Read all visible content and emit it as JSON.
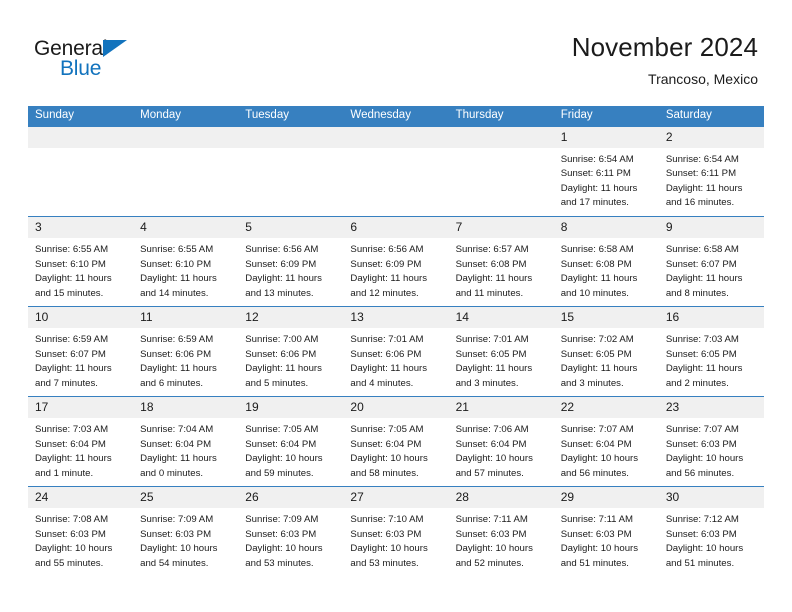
{
  "brand": {
    "name_part1": "General",
    "name_part2": "Blue",
    "accent_color": "#1273bd"
  },
  "header": {
    "title": "November 2024",
    "subtitle": "Trancoso, Mexico"
  },
  "theme": {
    "header_bg": "#3780c0",
    "daynum_bg": "#f0f0f0",
    "text_color": "#1b1b1b"
  },
  "calendar": {
    "weekday_headers": [
      "Sunday",
      "Monday",
      "Tuesday",
      "Wednesday",
      "Thursday",
      "Friday",
      "Saturday"
    ],
    "weeks": [
      [
        {
          "empty": true
        },
        {
          "empty": true
        },
        {
          "empty": true
        },
        {
          "empty": true
        },
        {
          "empty": true
        },
        {
          "day": "1",
          "sunrise": "Sunrise: 6:54 AM",
          "sunset": "Sunset: 6:11 PM",
          "daylight1": "Daylight: 11 hours",
          "daylight2": "and 17 minutes."
        },
        {
          "day": "2",
          "sunrise": "Sunrise: 6:54 AM",
          "sunset": "Sunset: 6:11 PM",
          "daylight1": "Daylight: 11 hours",
          "daylight2": "and 16 minutes."
        }
      ],
      [
        {
          "day": "3",
          "sunrise": "Sunrise: 6:55 AM",
          "sunset": "Sunset: 6:10 PM",
          "daylight1": "Daylight: 11 hours",
          "daylight2": "and 15 minutes."
        },
        {
          "day": "4",
          "sunrise": "Sunrise: 6:55 AM",
          "sunset": "Sunset: 6:10 PM",
          "daylight1": "Daylight: 11 hours",
          "daylight2": "and 14 minutes."
        },
        {
          "day": "5",
          "sunrise": "Sunrise: 6:56 AM",
          "sunset": "Sunset: 6:09 PM",
          "daylight1": "Daylight: 11 hours",
          "daylight2": "and 13 minutes."
        },
        {
          "day": "6",
          "sunrise": "Sunrise: 6:56 AM",
          "sunset": "Sunset: 6:09 PM",
          "daylight1": "Daylight: 11 hours",
          "daylight2": "and 12 minutes."
        },
        {
          "day": "7",
          "sunrise": "Sunrise: 6:57 AM",
          "sunset": "Sunset: 6:08 PM",
          "daylight1": "Daylight: 11 hours",
          "daylight2": "and 11 minutes."
        },
        {
          "day": "8",
          "sunrise": "Sunrise: 6:58 AM",
          "sunset": "Sunset: 6:08 PM",
          "daylight1": "Daylight: 11 hours",
          "daylight2": "and 10 minutes."
        },
        {
          "day": "9",
          "sunrise": "Sunrise: 6:58 AM",
          "sunset": "Sunset: 6:07 PM",
          "daylight1": "Daylight: 11 hours",
          "daylight2": "and 8 minutes."
        }
      ],
      [
        {
          "day": "10",
          "sunrise": "Sunrise: 6:59 AM",
          "sunset": "Sunset: 6:07 PM",
          "daylight1": "Daylight: 11 hours",
          "daylight2": "and 7 minutes."
        },
        {
          "day": "11",
          "sunrise": "Sunrise: 6:59 AM",
          "sunset": "Sunset: 6:06 PM",
          "daylight1": "Daylight: 11 hours",
          "daylight2": "and 6 minutes."
        },
        {
          "day": "12",
          "sunrise": "Sunrise: 7:00 AM",
          "sunset": "Sunset: 6:06 PM",
          "daylight1": "Daylight: 11 hours",
          "daylight2": "and 5 minutes."
        },
        {
          "day": "13",
          "sunrise": "Sunrise: 7:01 AM",
          "sunset": "Sunset: 6:06 PM",
          "daylight1": "Daylight: 11 hours",
          "daylight2": "and 4 minutes."
        },
        {
          "day": "14",
          "sunrise": "Sunrise: 7:01 AM",
          "sunset": "Sunset: 6:05 PM",
          "daylight1": "Daylight: 11 hours",
          "daylight2": "and 3 minutes."
        },
        {
          "day": "15",
          "sunrise": "Sunrise: 7:02 AM",
          "sunset": "Sunset: 6:05 PM",
          "daylight1": "Daylight: 11 hours",
          "daylight2": "and 3 minutes."
        },
        {
          "day": "16",
          "sunrise": "Sunrise: 7:03 AM",
          "sunset": "Sunset: 6:05 PM",
          "daylight1": "Daylight: 11 hours",
          "daylight2": "and 2 minutes."
        }
      ],
      [
        {
          "day": "17",
          "sunrise": "Sunrise: 7:03 AM",
          "sunset": "Sunset: 6:04 PM",
          "daylight1": "Daylight: 11 hours",
          "daylight2": "and 1 minute."
        },
        {
          "day": "18",
          "sunrise": "Sunrise: 7:04 AM",
          "sunset": "Sunset: 6:04 PM",
          "daylight1": "Daylight: 11 hours",
          "daylight2": "and 0 minutes."
        },
        {
          "day": "19",
          "sunrise": "Sunrise: 7:05 AM",
          "sunset": "Sunset: 6:04 PM",
          "daylight1": "Daylight: 10 hours",
          "daylight2": "and 59 minutes."
        },
        {
          "day": "20",
          "sunrise": "Sunrise: 7:05 AM",
          "sunset": "Sunset: 6:04 PM",
          "daylight1": "Daylight: 10 hours",
          "daylight2": "and 58 minutes."
        },
        {
          "day": "21",
          "sunrise": "Sunrise: 7:06 AM",
          "sunset": "Sunset: 6:04 PM",
          "daylight1": "Daylight: 10 hours",
          "daylight2": "and 57 minutes."
        },
        {
          "day": "22",
          "sunrise": "Sunrise: 7:07 AM",
          "sunset": "Sunset: 6:04 PM",
          "daylight1": "Daylight: 10 hours",
          "daylight2": "and 56 minutes."
        },
        {
          "day": "23",
          "sunrise": "Sunrise: 7:07 AM",
          "sunset": "Sunset: 6:03 PM",
          "daylight1": "Daylight: 10 hours",
          "daylight2": "and 56 minutes."
        }
      ],
      [
        {
          "day": "24",
          "sunrise": "Sunrise: 7:08 AM",
          "sunset": "Sunset: 6:03 PM",
          "daylight1": "Daylight: 10 hours",
          "daylight2": "and 55 minutes."
        },
        {
          "day": "25",
          "sunrise": "Sunrise: 7:09 AM",
          "sunset": "Sunset: 6:03 PM",
          "daylight1": "Daylight: 10 hours",
          "daylight2": "and 54 minutes."
        },
        {
          "day": "26",
          "sunrise": "Sunrise: 7:09 AM",
          "sunset": "Sunset: 6:03 PM",
          "daylight1": "Daylight: 10 hours",
          "daylight2": "and 53 minutes."
        },
        {
          "day": "27",
          "sunrise": "Sunrise: 7:10 AM",
          "sunset": "Sunset: 6:03 PM",
          "daylight1": "Daylight: 10 hours",
          "daylight2": "and 53 minutes."
        },
        {
          "day": "28",
          "sunrise": "Sunrise: 7:11 AM",
          "sunset": "Sunset: 6:03 PM",
          "daylight1": "Daylight: 10 hours",
          "daylight2": "and 52 minutes."
        },
        {
          "day": "29",
          "sunrise": "Sunrise: 7:11 AM",
          "sunset": "Sunset: 6:03 PM",
          "daylight1": "Daylight: 10 hours",
          "daylight2": "and 51 minutes."
        },
        {
          "day": "30",
          "sunrise": "Sunrise: 7:12 AM",
          "sunset": "Sunset: 6:03 PM",
          "daylight1": "Daylight: 10 hours",
          "daylight2": "and 51 minutes."
        }
      ]
    ]
  }
}
